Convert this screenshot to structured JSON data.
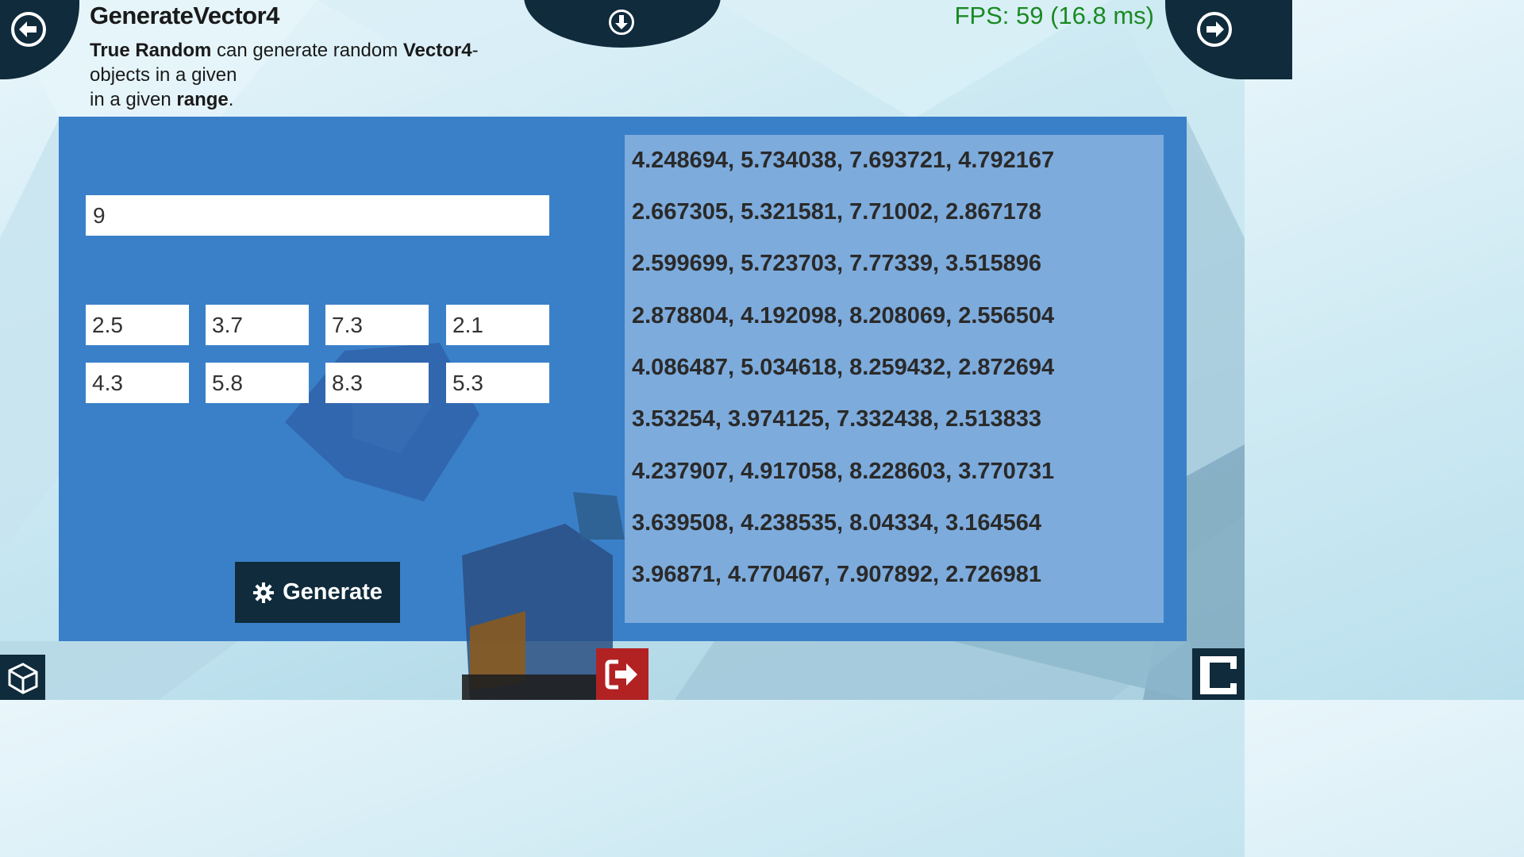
{
  "header": {
    "title": "GenerateVector4",
    "subtitle_part1": "True Random",
    "subtitle_part2": " can generate random ",
    "subtitle_part3": "Vector4",
    "subtitle_part4": "-objects in a given ",
    "subtitle_part5": "range",
    "subtitle_part6": ".",
    "fps": "FPS: 59 (16.8 ms)"
  },
  "nav": {
    "back_icon": "arrow-left-circle-icon",
    "next_icon": "arrow-right-circle-icon",
    "download_icon": "arrow-down-circle-icon"
  },
  "form": {
    "count_value": "9",
    "min_values": [
      "2.5",
      "3.7",
      "7.3",
      "2.1"
    ],
    "max_values": [
      "4.3",
      "5.8",
      "8.3",
      "5.3"
    ],
    "generate_label": "Generate",
    "generate_icon": "gear-icon"
  },
  "results": [
    "4.248694, 5.734038, 7.693721, 4.792167",
    "2.667305, 5.321581, 7.71002, 2.867178",
    "2.599699, 5.723703, 7.77339, 3.515896",
    "2.878804, 4.192098, 8.208069, 2.556504",
    "4.086487, 5.034618, 8.259432, 2.872694",
    "3.53254, 3.974125, 7.332438, 2.513833",
    "4.237907, 4.917058, 8.228603, 3.770731",
    "3.639508, 4.238535, 8.04334, 3.164564",
    "3.96871, 4.770467, 7.907892, 2.726981"
  ],
  "footer": {
    "exit_icon": "sign-out-icon",
    "unity_icon": "unity-logo-icon",
    "brand_icon": "crosstales-logo-icon"
  },
  "colors": {
    "panel": "#3a80c9",
    "dark": "#0f2b3c",
    "fps_green": "#1a8a22",
    "exit_red": "#b22222"
  }
}
